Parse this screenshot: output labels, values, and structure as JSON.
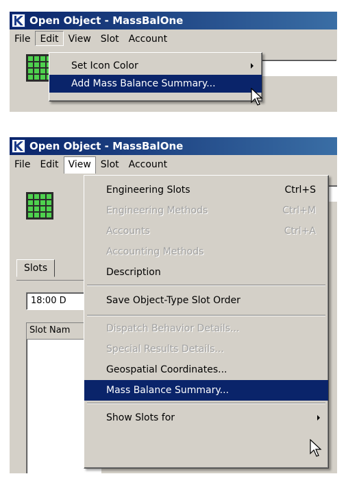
{
  "window": {
    "title": "Open Object - MassBalOne"
  },
  "menubar": {
    "file": "File",
    "edit": "Edit",
    "view": "View",
    "slot": "Slot",
    "account": "Account"
  },
  "edit_menu": {
    "items": [
      {
        "label": "Set Icon Color"
      },
      {
        "label": "Add Mass Balance Summary..."
      }
    ]
  },
  "view_menu": {
    "items": [
      {
        "label": "Engineering Slots",
        "shortcut": "Ctrl+S"
      },
      {
        "label": "Engineering Methods",
        "shortcut": "Ctrl+M"
      },
      {
        "label": "Accounts",
        "shortcut": "Ctrl+A"
      },
      {
        "label": "Accounting Methods"
      },
      {
        "label": "Description"
      },
      {
        "label": "Save Object-Type Slot Order"
      },
      {
        "label": "Dispatch Behavior Details..."
      },
      {
        "label": "Special Results Details..."
      },
      {
        "label": "Geospatial Coordinates..."
      },
      {
        "label": "Mass Balance Summary..."
      },
      {
        "label": "Show Slots for"
      }
    ]
  },
  "background": {
    "tab_slots": "Slots",
    "date_field": "18:00 D",
    "slot_name_header": "Slot Nam"
  },
  "colors": {
    "titlebar": "#0a246a",
    "selection": "#0a246a",
    "icon_green": "#4ed14e",
    "face": "#d4d0c8"
  }
}
